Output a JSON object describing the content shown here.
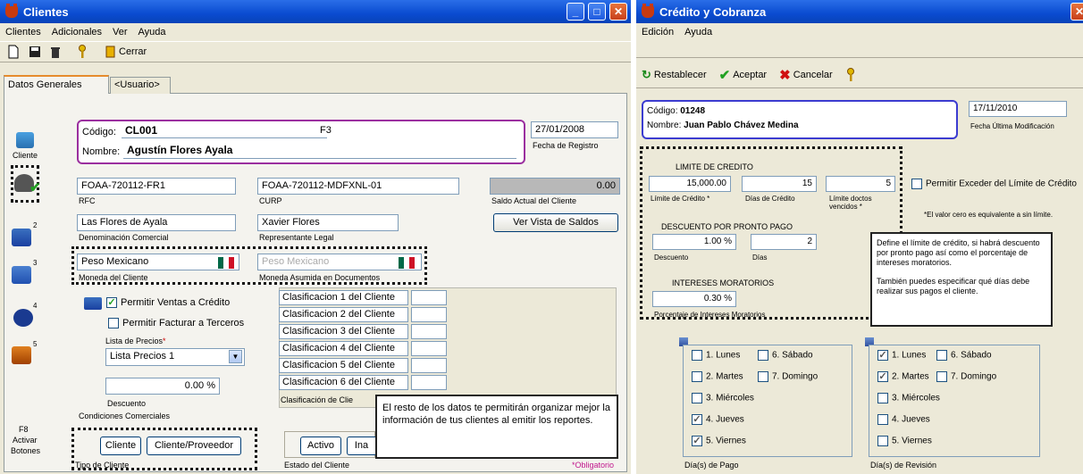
{
  "clientes": {
    "title": "Clientes",
    "menu": [
      "Clientes",
      "Adicionales",
      "Ver",
      "Ayuda"
    ],
    "toolbar": {
      "close_label": "Cerrar"
    },
    "tabs": [
      "Datos Generales",
      "<Usuario>"
    ],
    "side": {
      "cliente_label": "Cliente",
      "f8_label": "F8",
      "activar_label": "Activar",
      "botones_label": "Botones",
      "badges": [
        "2",
        "3",
        "4",
        "5"
      ]
    },
    "codigo_label": "Código:",
    "codigo_value": "CL001",
    "f3_label": "F3",
    "nombre_label": "Nombre:",
    "nombre_value": "Agustín Flores Ayala",
    "fecha_value": "27/01/2008",
    "fecha_label": "Fecha de Registro",
    "rfc_value": "FOAA-720112-FR1",
    "rfc_label": "RFC",
    "curp_value": "FOAA-720112-MDFXNL-01",
    "curp_label": "CURP",
    "saldo_value": "0.00",
    "saldo_label": "Saldo Actual del Cliente",
    "denominacion_value": "Las Flores de Ayala",
    "denominacion_label": "Denominación Comercial",
    "representante_value": "Xavier Flores",
    "representante_label": "Representante Legal",
    "ver_saldos_button": "Ver Vista de Saldos",
    "moneda_value": "Peso Mexicano",
    "moneda_label": "Moneda del Cliente",
    "moneda_doc_value": "Peso Mexicano",
    "moneda_doc_label": "Moneda Asumida en Documentos",
    "permitir_ventas": "Permitir Ventas a Crédito",
    "permitir_facturar": "Permitir Facturar a Terceros",
    "lista_precios_label": "Lista de Precios",
    "lista_precios_value": "Lista Precios 1",
    "descuento_value": "0.00 %",
    "descuento_label": "Descuento",
    "condiciones_label": "Condiciones Comerciales",
    "clasificaciones": [
      "Clasificacion 1 del Cliente",
      "Clasificacion 2 del Cliente",
      "Clasificacion 3 del Cliente",
      "Clasificacion 4 del Cliente",
      "Clasificacion 5 del Cliente",
      "Clasificacion 6 del Cliente"
    ],
    "clasificacion_label": "Clasificación de Clie",
    "tooltip": "El resto de los datos te permitirán organizar mejor la información de tus clientes al emitir los reportes.",
    "tipo_cliente_buttons": [
      "Cliente",
      "Cliente/Proveedor"
    ],
    "tipo_cliente_label": "Tipo de Cliente",
    "estado_buttons": [
      "Activo",
      "Ina"
    ],
    "estado_label": "Estado del Cliente",
    "obligatorio_label": "*Obligatorio"
  },
  "credito": {
    "title": "Crédito y Cobranza",
    "menu": [
      "Edición",
      "Ayuda"
    ],
    "toolbar": {
      "restablecer": "Restablecer",
      "aceptar": "Aceptar",
      "cancelar": "Cancelar"
    },
    "codigo_label": "Código:",
    "codigo_value": "01248",
    "nombre_label": "Nombre:",
    "nombre_value": "Juan Pablo Chávez Medina",
    "fecha_value": "17/11/2010",
    "fecha_label": "Fecha Última Modificación",
    "limite_title": "LIMITE DE CREDITO",
    "limite_value": "15,000.00",
    "limite_label": "Límite de Crédito *",
    "dias_value": "15",
    "dias_label": "Días de Crédito",
    "docs_value": "5",
    "docs_label": "Límite doctos vencidos *",
    "permitir_exceder": "Permitir Exceder del Límite de Crédito",
    "valor_cero_note": "*El valor cero es equivalente a sin límite.",
    "descuento_title": "DESCUENTO POR PRONTO PAGO",
    "descuento_value": "1.00 %",
    "descuento_label": "Descuento",
    "descuento_dias_value": "2",
    "descuento_dias_label": "Días",
    "intereses_title": "INTERESES MORATORIOS",
    "intereses_value": "0.30 %",
    "intereses_label": "Porcentaje de Intereses Moratorios",
    "tooltip_1": "Define el límite de crédito, si habrá descuento por pronto pago así como el porcentaje de intereses moratorios.",
    "tooltip_2": "También puedes especificar qué días debe realizar sus pagos el cliente.",
    "pago_days": [
      {
        "label": "1. Lunes",
        "checked": false
      },
      {
        "label": "6. Sábado",
        "checked": false
      },
      {
        "label": "2. Martes",
        "checked": false
      },
      {
        "label": "7. Domingo",
        "checked": false
      },
      {
        "label": "3. Miércoles",
        "checked": false
      },
      {
        "label": "4. Jueves",
        "checked": true
      },
      {
        "label": "5. Viernes",
        "checked": true
      }
    ],
    "pago_label": "Día(s) de Pago",
    "revision_days": [
      {
        "label": "1. Lunes",
        "checked": true
      },
      {
        "label": "6. Sábado",
        "checked": false
      },
      {
        "label": "2. Martes",
        "checked": true
      },
      {
        "label": "7. Domingo",
        "checked": false
      },
      {
        "label": "3. Miércoles",
        "checked": false
      },
      {
        "label": "4. Jueves",
        "checked": false
      },
      {
        "label": "5. Viernes",
        "checked": false
      }
    ],
    "revision_label": "Día(s) de Revisión"
  }
}
